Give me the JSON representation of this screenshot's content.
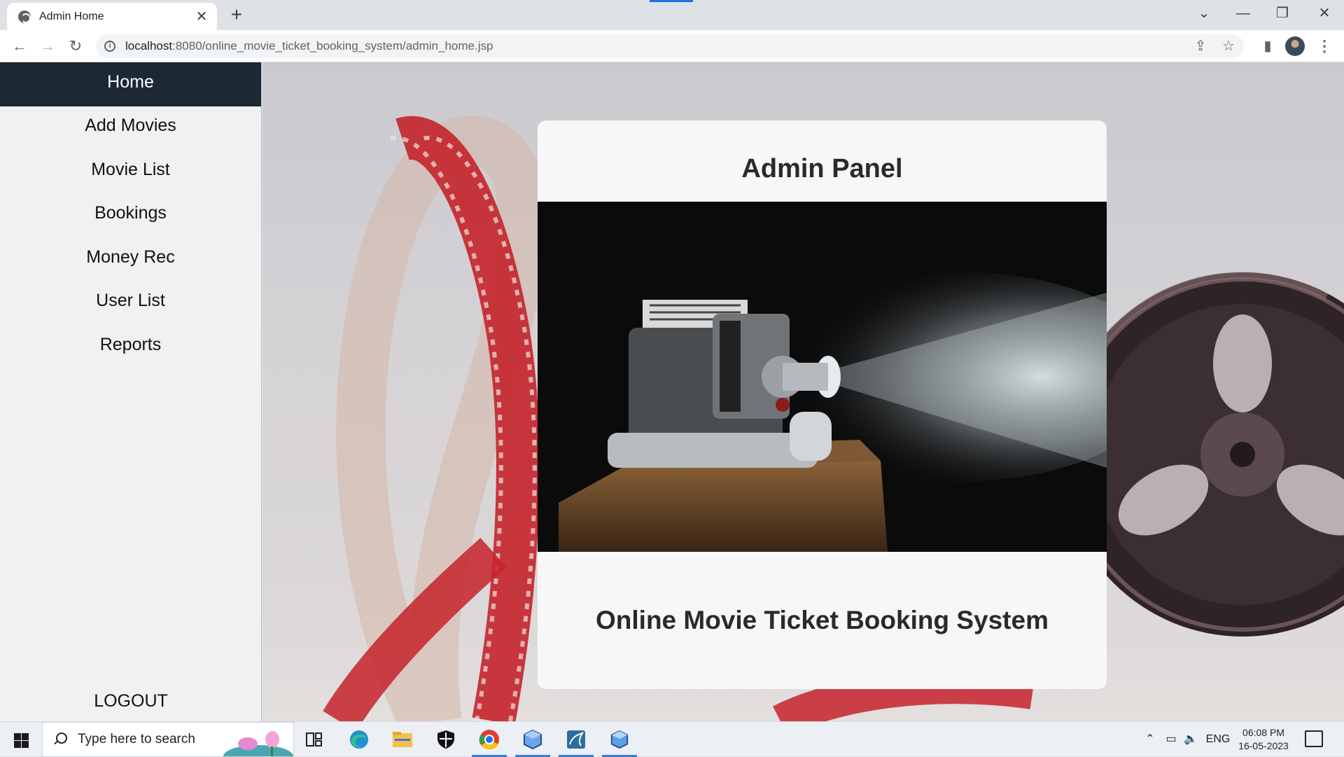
{
  "browser": {
    "tab_title": "Admin Home",
    "tab_close": "✕",
    "new_tab": "+",
    "url_host": "localhost",
    "url_path": ":8080/online_movie_ticket_booking_system/admin_home.jsp",
    "controls": {
      "tab_search": "⌄",
      "minimize": "—",
      "maximize": "❐",
      "close": "✕"
    }
  },
  "sidebar": {
    "items": [
      {
        "label": "Home",
        "active": true
      },
      {
        "label": "Add Movies"
      },
      {
        "label": "Movie List"
      },
      {
        "label": "Bookings"
      },
      {
        "label": "Money Rec"
      },
      {
        "label": "User List"
      },
      {
        "label": "Reports"
      }
    ],
    "logout_label": "LOGOUT"
  },
  "card": {
    "title": "Admin Panel",
    "subtitle": "Online Movie Ticket Booking System"
  },
  "taskbar": {
    "search_placeholder": "Type here to search",
    "language": "ENG",
    "time": "06:08 PM",
    "date": "16-05-2023"
  },
  "colors": {
    "sidebar_active_bg": "#1c2833",
    "sidebar_bg": "#f1f1f1",
    "card_bg": "#f7f7f7",
    "film_red": "#c4232a",
    "accent_blue": "#1a73e8"
  },
  "icons": {
    "browser": [
      "globe-icon",
      "close-icon",
      "plus-icon",
      "back-arrow-icon",
      "forward-arrow-icon",
      "reload-icon",
      "info-icon",
      "share-icon",
      "star-icon",
      "side-panel-icon",
      "kebab-menu-icon"
    ],
    "taskbar": [
      "windows-start-icon",
      "search-icon",
      "task-view-icon",
      "edge-icon",
      "file-explorer-icon",
      "security-shield-icon",
      "chrome-icon",
      "virtualbox-icon",
      "mysql-workbench-icon",
      "cube-app-icon",
      "chevron-up-icon",
      "battery-icon",
      "speaker-icon",
      "notification-icon"
    ]
  }
}
